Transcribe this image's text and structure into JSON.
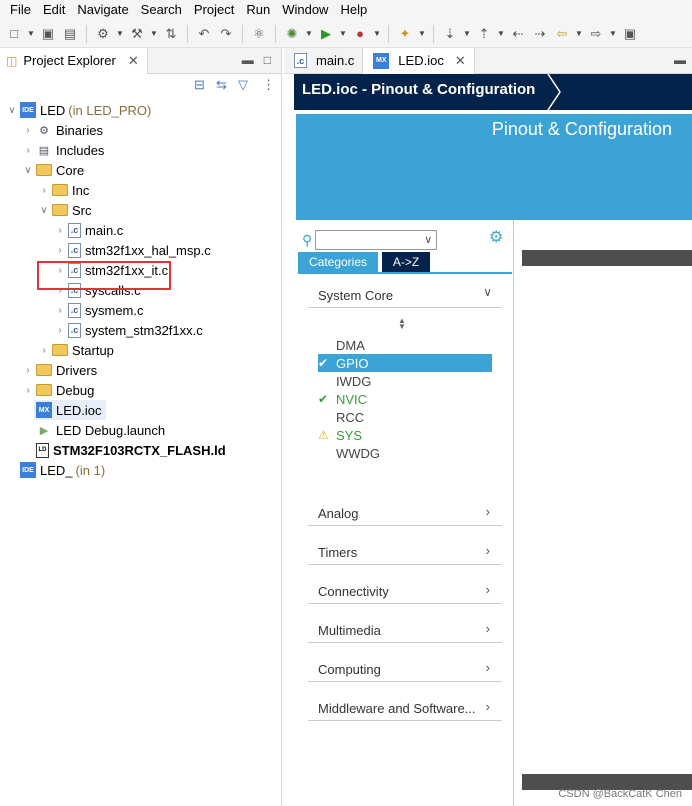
{
  "menu": [
    "File",
    "Edit",
    "Navigate",
    "Search",
    "Project",
    "Run",
    "Window",
    "Help"
  ],
  "project_explorer": {
    "tab_label": "Project Explorer",
    "tree": [
      {
        "label": "LED",
        "suffix": "(in LED_PRO)",
        "icon": "ide-icon"
      },
      {
        "label": "Binaries",
        "icon": "binaries-icon"
      },
      {
        "label": "Includes",
        "icon": "includes-icon"
      },
      {
        "label": "Core",
        "icon": "folder-icon"
      },
      {
        "label": "Inc",
        "icon": "folder-icon"
      },
      {
        "label": "Src",
        "icon": "folder-icon"
      },
      {
        "label": "main.c",
        "icon": "c-file-icon"
      },
      {
        "label": "stm32f1xx_hal_msp.c",
        "icon": "c-file-icon"
      },
      {
        "label": "stm32f1xx_it.c",
        "icon": "c-file-icon"
      },
      {
        "label": "syscalls.c",
        "icon": "c-file-icon"
      },
      {
        "label": "sysmem.c",
        "icon": "c-file-icon"
      },
      {
        "label": "system_stm32f1xx.c",
        "icon": "c-file-icon"
      },
      {
        "label": "Startup",
        "icon": "folder-icon"
      },
      {
        "label": "Drivers",
        "icon": "folder-icon"
      },
      {
        "label": "Debug",
        "icon": "folder-icon"
      },
      {
        "label": "LED.ioc",
        "icon": "mx-icon"
      },
      {
        "label": "LED Debug.launch",
        "icon": "launch-icon"
      },
      {
        "label": "STM32F103RCTX_FLASH.ld",
        "icon": "ld-icon"
      },
      {
        "label": "LED_",
        "suffix": "(in 1)",
        "icon": "ide-icon"
      }
    ]
  },
  "editor": {
    "tabs": [
      {
        "label": "main.c",
        "icon": "c-file-icon"
      },
      {
        "label": "LED.ioc",
        "icon": "mx-icon"
      }
    ],
    "breadcrumb": "LED.ioc - Pinout & Configuration",
    "banner_title": "Pinout & Configuration",
    "category_tabs": [
      "Categories",
      "A->Z"
    ],
    "system_core_label": "System Core",
    "peripherals": [
      {
        "label": "DMA",
        "status": "none"
      },
      {
        "label": "GPIO",
        "status": "ok-selected"
      },
      {
        "label": "IWDG",
        "status": "none"
      },
      {
        "label": "NVIC",
        "status": "ok"
      },
      {
        "label": "RCC",
        "status": "none"
      },
      {
        "label": "SYS",
        "status": "warning"
      },
      {
        "label": "WWDG",
        "status": "none"
      }
    ],
    "categories": [
      "Analog",
      "Timers",
      "Connectivity",
      "Multimedia",
      "Computing",
      "Middleware and Software..."
    ]
  },
  "colors": {
    "dark_blue": "#03234b",
    "st_blue": "#3ca3d6",
    "highlight_red": "#e0333a",
    "ok_green": "#3a9a3a",
    "warning_yellow": "#f0b400"
  },
  "watermark": "CSDN @BackCatK Chen"
}
